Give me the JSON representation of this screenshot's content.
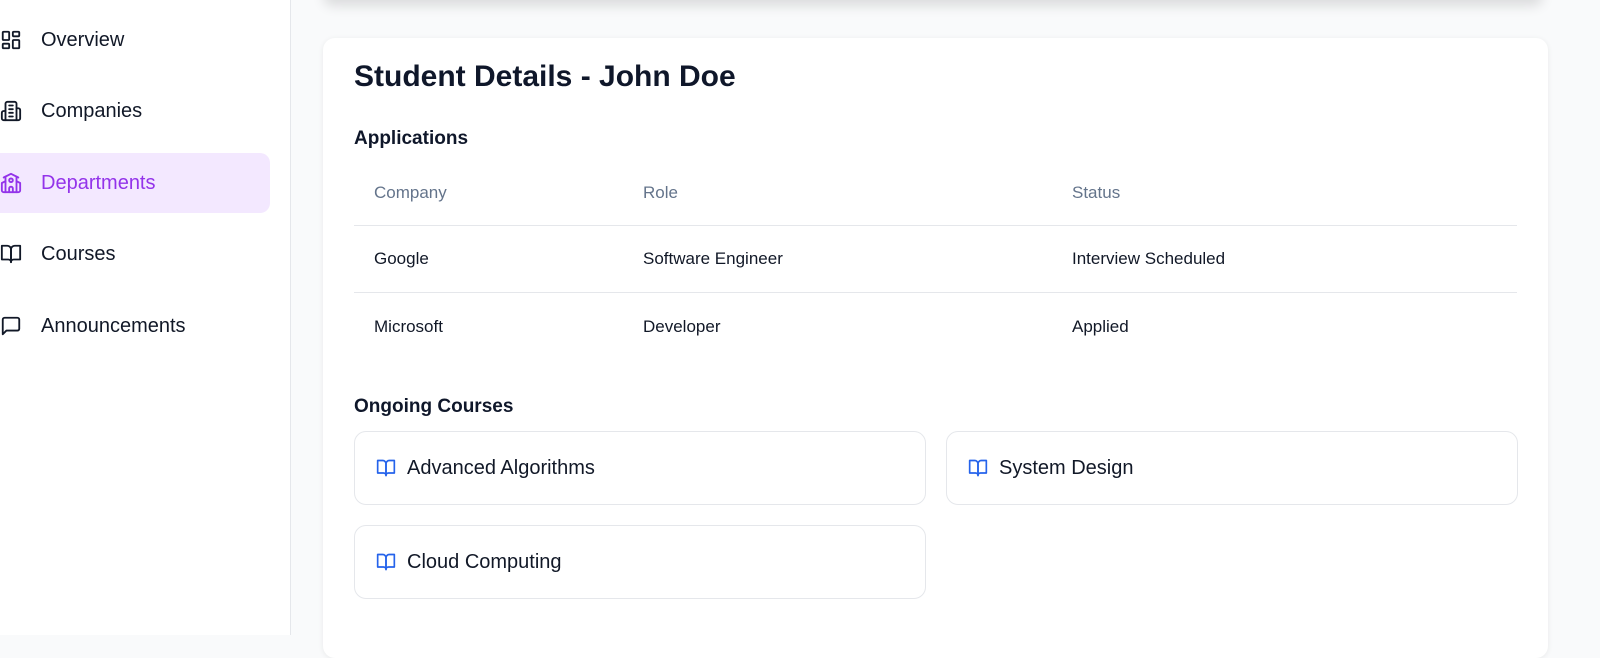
{
  "sidebar": {
    "items": [
      {
        "label": "Overview",
        "icon": "overview-icon",
        "active": false
      },
      {
        "label": "Companies",
        "icon": "building-icon",
        "active": false
      },
      {
        "label": "Departments",
        "icon": "school-icon",
        "active": true
      },
      {
        "label": "Courses",
        "icon": "book-open-icon",
        "active": false
      },
      {
        "label": "Announcements",
        "icon": "message-square-icon",
        "active": false
      }
    ],
    "active_color": "#9333ea",
    "active_bg": "#f3e8ff"
  },
  "main": {
    "title": "Student Details - John Doe",
    "applications": {
      "heading": "Applications",
      "columns": [
        "Company",
        "Role",
        "Status"
      ],
      "rows": [
        [
          "Google",
          "Software Engineer",
          "Interview Scheduled"
        ],
        [
          "Microsoft",
          "Developer",
          "Applied"
        ]
      ]
    },
    "courses": {
      "heading": "Ongoing Courses",
      "items": [
        "Advanced Algorithms",
        "System Design",
        "Cloud Computing"
      ],
      "icon": "book-open-icon",
      "icon_color": "#2563eb"
    }
  }
}
